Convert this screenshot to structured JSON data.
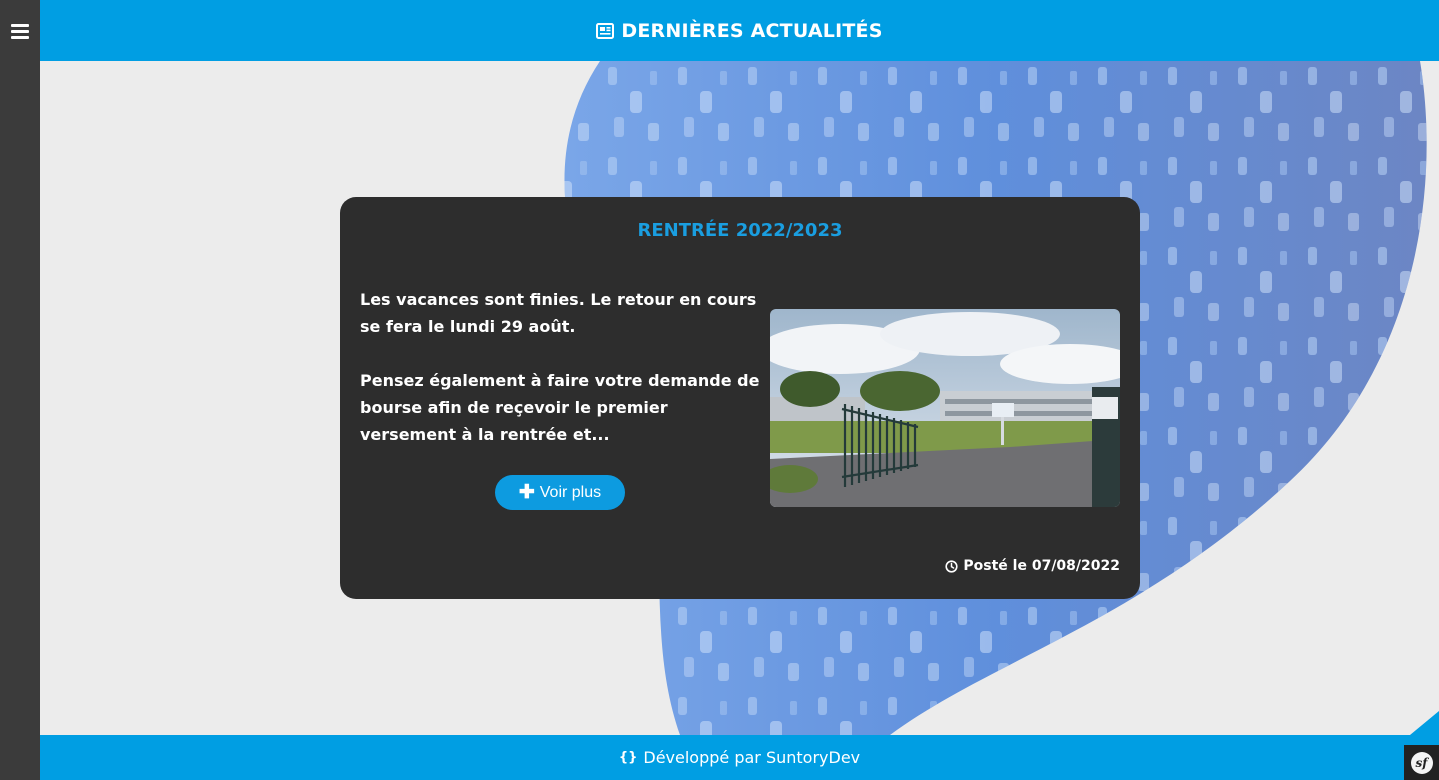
{
  "header": {
    "title": "DERNIÈRES ACTUALITÉS",
    "icon": "newspaper-icon",
    "bg_color": "#009ee3"
  },
  "sidebar": {
    "menu_icon": "hamburger-menu-icon",
    "bg_color": "#3b3b3b"
  },
  "article": {
    "title": "RENTRÉE 2022/2023",
    "paragraph1": "Les vacances sont finies. Le retour en cours se fera le lundi 29 août.",
    "paragraph2": "Pensez également à faire votre demande de bourse afin de reçevoir le premier versement à la rentrée et...",
    "more_label": "Voir plus",
    "more_icon": "plus-icon",
    "posted": "Posté le 07/08/2022",
    "posted_icon": "clock-icon",
    "image": "school-entrance-photo",
    "title_color": "#1a9ee0"
  },
  "footer": {
    "text": "Développé par SuntoryDev",
    "icon": "code-braces-icon"
  },
  "debug_toolbar": {
    "icon": "symfony-logo-icon",
    "label": "sf"
  }
}
